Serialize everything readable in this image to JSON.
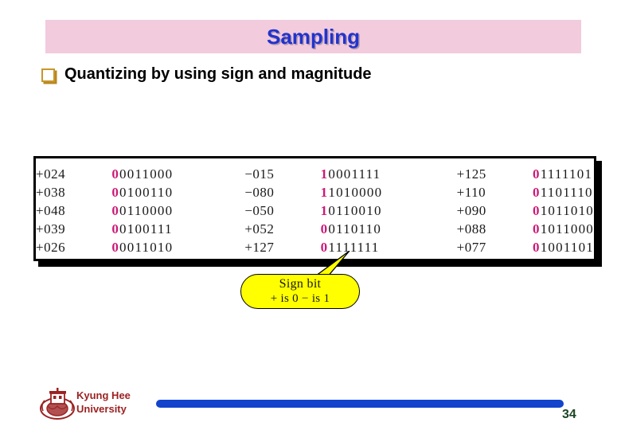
{
  "slide": {
    "title": "Sampling",
    "title_band_color": "#f2cbdd",
    "title_text_color": "#2233cc",
    "bullet_icon": "hollow-square-bullet-icon",
    "bullet_text": "Quantizing by using sign and magnitude"
  },
  "figure": {
    "sign_bit_color": "#cc1a77",
    "rows": [
      {
        "dec1": "+024",
        "bin1_sign": "0",
        "bin1_rest": "0011000",
        "dec2": "−015",
        "bin2_sign": "1",
        "bin2_rest": "0001111",
        "dec3": "+125",
        "bin3_sign": "0",
        "bin3_rest": "1111101"
      },
      {
        "dec1": "+038",
        "bin1_sign": "0",
        "bin1_rest": "0100110",
        "dec2": "−080",
        "bin2_sign": "1",
        "bin2_rest": "1010000",
        "dec3": "+110",
        "bin3_sign": "0",
        "bin3_rest": "1101110"
      },
      {
        "dec1": "+048",
        "bin1_sign": "0",
        "bin1_rest": "0110000",
        "dec2": "−050",
        "bin2_sign": "1",
        "bin2_rest": "0110010",
        "dec3": "+090",
        "bin3_sign": "0",
        "bin3_rest": "1011010"
      },
      {
        "dec1": "+039",
        "bin1_sign": "0",
        "bin1_rest": "0100111",
        "dec2": "+052",
        "bin2_sign": "0",
        "bin2_rest": "0110110",
        "dec3": "+088",
        "bin3_sign": "0",
        "bin3_rest": "1011000"
      },
      {
        "dec1": "+026",
        "bin1_sign": "0",
        "bin1_rest": "0011010",
        "dec2": "+127",
        "bin2_sign": "0",
        "bin2_rest": "1111111",
        "dec3": "+077",
        "bin3_sign": "0",
        "bin3_rest": "1001101"
      }
    ]
  },
  "callout": {
    "line1": "Sign bit",
    "line2": "+ is 0   − is 1",
    "fill_color": "#ffff00"
  },
  "footer": {
    "logo_icon": "kyung-hee-university-crest-icon",
    "university_line1": "Kyung Hee",
    "university_line2": "University",
    "university_color": "#9c2222",
    "bar_color": "#1244cc",
    "page_number": "34",
    "page_number_color": "#1d4423"
  }
}
